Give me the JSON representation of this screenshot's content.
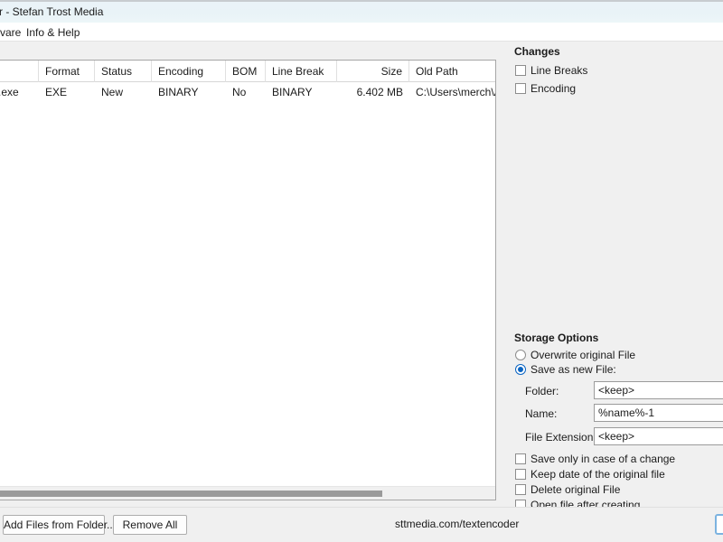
{
  "window": {
    "title": "r - Stefan Trost Media"
  },
  "menu": {
    "items": [
      {
        "label": "vare"
      },
      {
        "label": "Info & Help"
      }
    ]
  },
  "file_table": {
    "columns": [
      {
        "key": "name",
        "label": "",
        "align": "left"
      },
      {
        "key": "format",
        "label": "Format",
        "align": "left"
      },
      {
        "key": "status",
        "label": "Status",
        "align": "left"
      },
      {
        "key": "encoding",
        "label": "Encoding",
        "align": "left"
      },
      {
        "key": "bom",
        "label": "BOM",
        "align": "left"
      },
      {
        "key": "linebreak",
        "label": "Line Break",
        "align": "left"
      },
      {
        "key": "size",
        "label": "Size",
        "align": "right"
      },
      {
        "key": "oldpath",
        "label": "Old Path",
        "align": "left"
      }
    ],
    "rows": [
      {
        "name": "c.exe",
        "format": "EXE",
        "status": "New",
        "encoding": "BINARY",
        "bom": "No",
        "linebreak": "BINARY",
        "size": "6.402 MB",
        "oldpath": "C:\\Users\\merch\\App"
      }
    ]
  },
  "toolbar": {
    "add_files_label": "Add Files from Folder...",
    "remove_all_label": "Remove All",
    "website": "sttmedia.com/textencoder"
  },
  "changes": {
    "title": "Changes",
    "options": [
      {
        "label": "Line Breaks",
        "checked": false
      },
      {
        "label": "Encoding",
        "checked": false
      }
    ]
  },
  "storage": {
    "title": "Storage Options",
    "mode_options": [
      {
        "label": "Overwrite original File",
        "selected": false
      },
      {
        "label": "Save as new File:",
        "selected": true
      }
    ],
    "fields": [
      {
        "label": "Folder:",
        "value": "<keep>"
      },
      {
        "label": "Name:",
        "value": "%name%-1"
      },
      {
        "label": "File Extension:",
        "value": "<keep>"
      }
    ],
    "checkboxes": [
      {
        "label": "Save only in case of a change",
        "checked": false
      },
      {
        "label": "Keep date of the original file",
        "checked": false
      },
      {
        "label": "Delete original File",
        "checked": false
      },
      {
        "label": "Open file after creating",
        "checked": false
      }
    ]
  },
  "colors": {
    "titlebar": "#eaf3f8",
    "accent": "#0a64c2",
    "panel": "#f0f0f0",
    "focus_border": "#7cb3e0"
  }
}
